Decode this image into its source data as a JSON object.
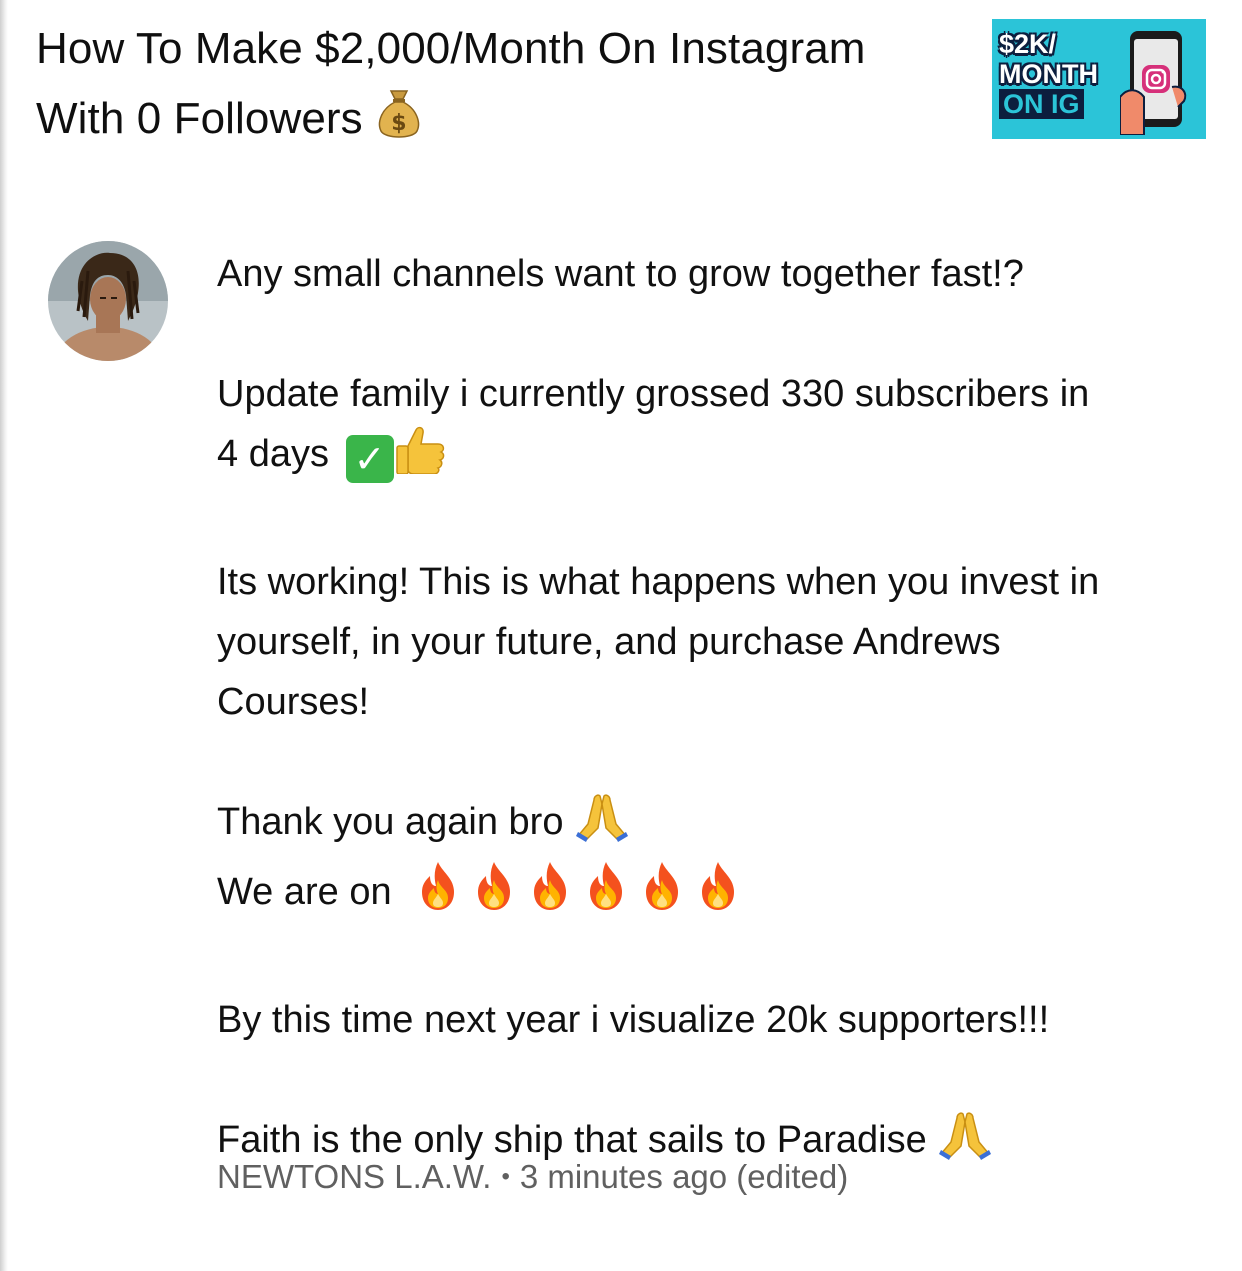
{
  "video": {
    "title_line1": "How To Make $2,000/Month On Instagram",
    "title_line2": "With 0 Followers",
    "title_emoji": "money-bag-icon",
    "thumbnail": {
      "line1": "$2K/",
      "line2": "MONTH",
      "line3": "ON IG",
      "bg_color": "#2bc4d8"
    }
  },
  "comment": {
    "lines": {
      "l1": "Any small channels want to grow together fast!?",
      "l2": "Update family i currently grossed 330 subscribers in",
      "l3": "4 days",
      "l4": "Its working! This is what happens when you invest in",
      "l5": "yourself, in your future, and purchase Andrews",
      "l6": "Courses!",
      "l7": "Thank you again bro",
      "l8": "We are on",
      "l9": "By this time next year i visualize 20k supporters!!!",
      "l10": "Faith is the only ship that sails to Paradise"
    },
    "emojis": [
      "check-mark-button-icon",
      "thumbs-up-icon",
      "folded-hands-icon",
      "fire-icon",
      "folded-hands-icon"
    ],
    "fire_count": 6,
    "author": "NEWTONS L.A.W.",
    "separator": "•",
    "timestamp": "3 minutes ago (edited)"
  },
  "colors": {
    "text": "#111111",
    "meta": "#606060"
  }
}
